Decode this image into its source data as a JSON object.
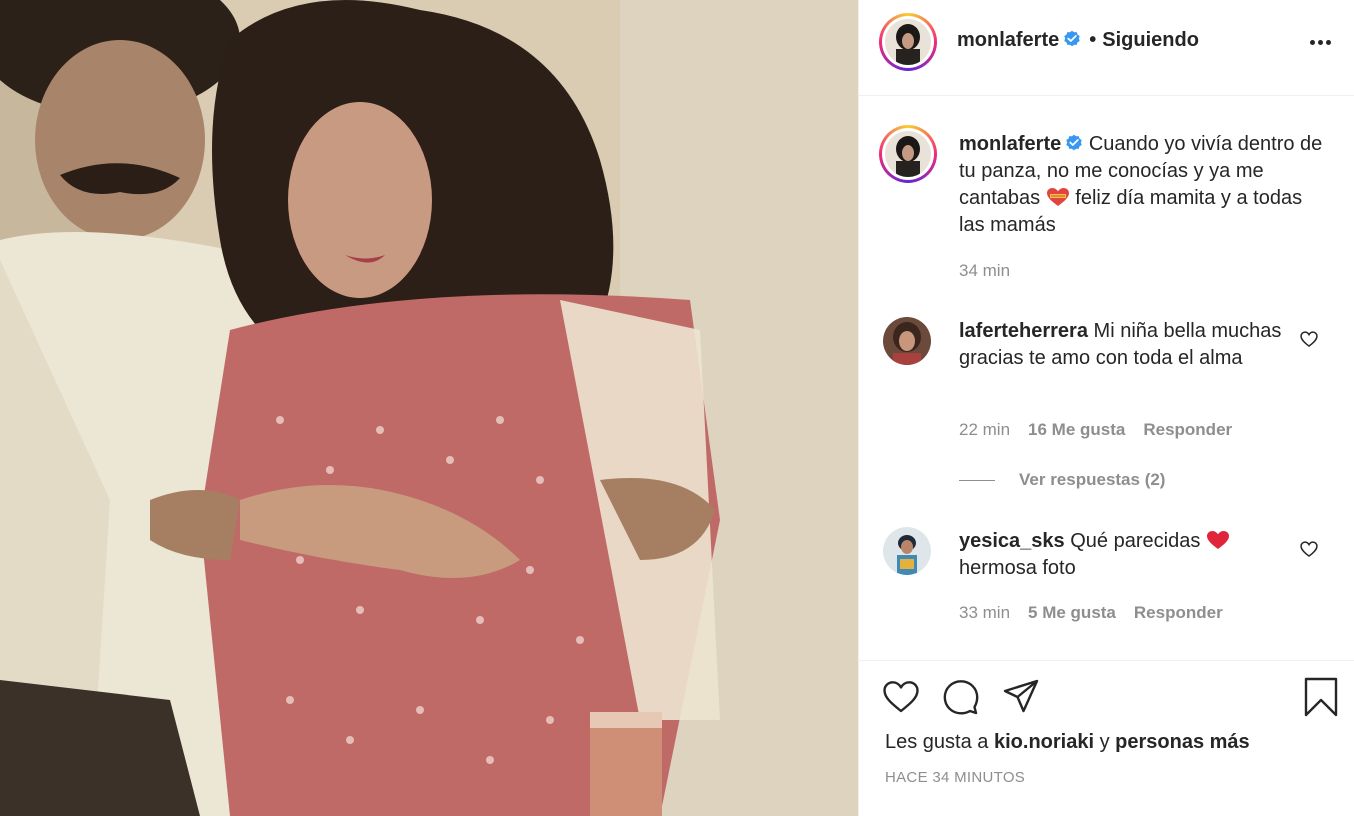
{
  "photo": {
    "description_icon": "photo-icon"
  },
  "header": {
    "username": "monlaferte",
    "separator": "•",
    "follow_status": "Siguiendo"
  },
  "caption": {
    "username": "monlaferte",
    "text_before_emoji": "Cuando yo vivía dentro de tu panza, no me conocías y ya me cantabas",
    "text_after_emoji": "feliz día mamita y a todas las mamás",
    "time": "34 min"
  },
  "comments": [
    {
      "username": "laferteherrera",
      "text": "Mi niña bella muchas gracias te amo con toda el alma",
      "time": "22 min",
      "likes": "16 Me gusta",
      "reply": "Responder"
    },
    {
      "username": "yesica_sks",
      "text_before_emoji": "Qué parecidas",
      "text_after_emoji": "hermosa foto",
      "time": "33 min",
      "likes": "5 Me gusta",
      "reply": "Responder"
    }
  ],
  "view_replies": "Ver respuestas (2)",
  "footer": {
    "likes_prefix": "Les gusta a",
    "liker": "kio.noriaki",
    "likes_mid": "y",
    "likes_suffix": "personas más",
    "timestamp": "HACE 34 MINUTOS"
  },
  "colors": {
    "text": "#262626",
    "secondary": "#8e8e8e",
    "verified": "#3897f0",
    "heart": "#ed4956"
  }
}
